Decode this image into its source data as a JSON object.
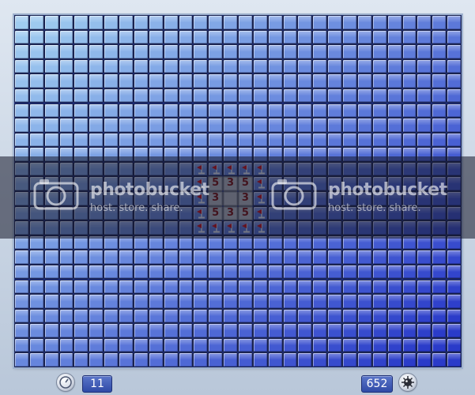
{
  "board": {
    "cols": 30,
    "rows": 24,
    "revealed": [
      {
        "row": 11,
        "col": 13,
        "value": "5"
      },
      {
        "row": 11,
        "col": 14,
        "value": "3"
      },
      {
        "row": 11,
        "col": 15,
        "value": "5"
      },
      {
        "row": 12,
        "col": 13,
        "value": "3"
      },
      {
        "row": 12,
        "col": 14,
        "value": ""
      },
      {
        "row": 12,
        "col": 15,
        "value": "3"
      },
      {
        "row": 13,
        "col": 13,
        "value": "5"
      },
      {
        "row": 13,
        "col": 14,
        "value": "3"
      },
      {
        "row": 13,
        "col": 15,
        "value": "5"
      }
    ],
    "flagged": [
      {
        "row": 10,
        "col": 12
      },
      {
        "row": 10,
        "col": 13
      },
      {
        "row": 10,
        "col": 14
      },
      {
        "row": 10,
        "col": 15
      },
      {
        "row": 10,
        "col": 16
      },
      {
        "row": 11,
        "col": 12
      },
      {
        "row": 11,
        "col": 16
      },
      {
        "row": 12,
        "col": 12
      },
      {
        "row": 12,
        "col": 16
      },
      {
        "row": 13,
        "col": 12
      },
      {
        "row": 13,
        "col": 16
      },
      {
        "row": 14,
        "col": 12
      },
      {
        "row": 14,
        "col": 13
      },
      {
        "row": 14,
        "col": 14
      },
      {
        "row": 14,
        "col": 15
      },
      {
        "row": 14,
        "col": 16
      }
    ],
    "colors": {
      "tile_top_left": "#a6d4f2",
      "tile_bottom_right": "#2a3bc9",
      "flag": "#c8101a"
    }
  },
  "watermark": {
    "brand": "photobucket",
    "tagline": "host. store. share."
  },
  "status": {
    "timer_icon": "stopwatch-icon",
    "time_value": "11",
    "mines_value": "652",
    "mine_icon": "mine-icon"
  }
}
